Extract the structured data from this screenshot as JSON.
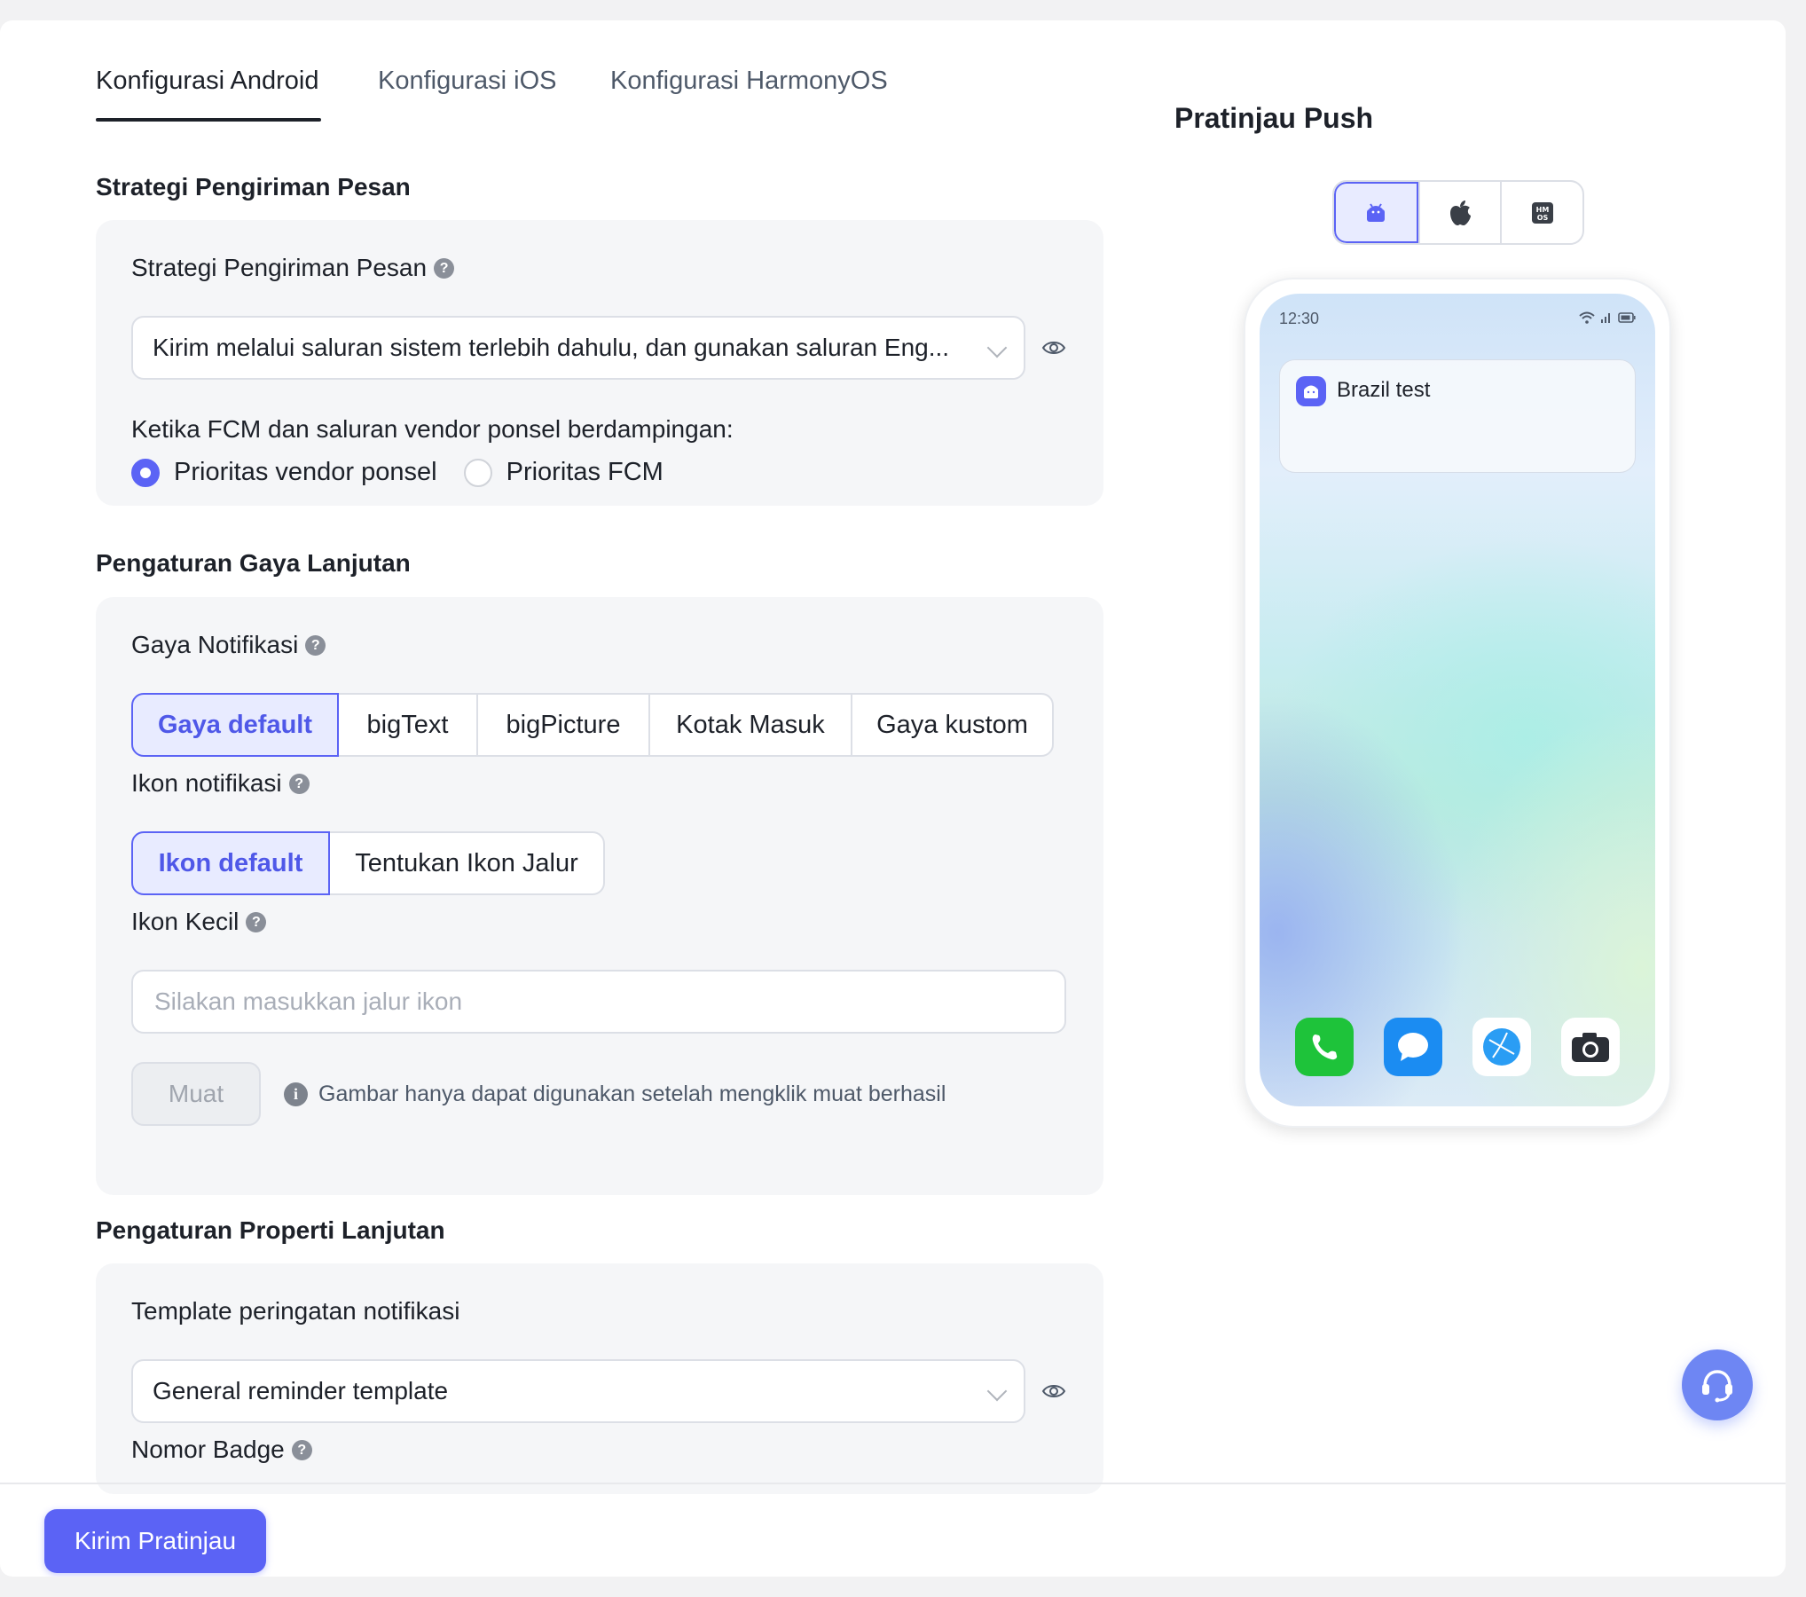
{
  "tabs": [
    {
      "label": "Konfigurasi Android",
      "active": true
    },
    {
      "label": "Konfigurasi iOS",
      "active": false
    },
    {
      "label": "Konfigurasi HarmonyOS",
      "active": false
    }
  ],
  "delivery": {
    "section_title": "Strategi Pengiriman Pesan",
    "field_label": "Strategi Pengiriman Pesan",
    "select_value": "Kirim melalui saluran sistem terlebih dahulu, dan gunakan saluran Eng...",
    "coexist_label": "Ketika FCM dan saluran vendor ponsel berdampingan:",
    "radio_options": [
      "Prioritas vendor ponsel",
      "Prioritas FCM"
    ],
    "radio_selected": 0
  },
  "style": {
    "section_title": "Pengaturan Gaya Lanjutan",
    "notif_style_label": "Gaya Notifikasi",
    "notif_style_options": [
      "Gaya default",
      "bigText",
      "bigPicture",
      "Kotak Masuk",
      "Gaya kustom"
    ],
    "notif_style_selected": 0,
    "icon_label": "Ikon notifikasi",
    "icon_options": [
      "Ikon default",
      "Tentukan Ikon Jalur"
    ],
    "icon_selected": 0,
    "small_icon_label": "Ikon Kecil",
    "small_icon_placeholder": "Silakan masukkan jalur ikon",
    "load_button": "Muat",
    "load_hint": "Gambar hanya dapat digunakan setelah mengklik muat berhasil"
  },
  "properties": {
    "section_title": "Pengaturan Properti Lanjutan",
    "template_label": "Template peringatan notifikasi",
    "template_value": "General reminder template",
    "badge_label": "Nomor Badge"
  },
  "preview": {
    "title": "Pratinjau Push",
    "os_options": [
      "android-icon",
      "apple-icon",
      "harmonyos-icon"
    ],
    "os_selected": 0,
    "status_time": "12:30",
    "notification_title": "Brazil test",
    "dock_apps": [
      "phone-app-icon",
      "messages-app-icon",
      "browser-app-icon",
      "camera-app-icon"
    ]
  },
  "footer": {
    "send_button": "Kirim Pratinjau"
  },
  "colors": {
    "accent": "#5b63f5",
    "accent_light": "#e8ebff",
    "support_button": "#6e86f3"
  }
}
